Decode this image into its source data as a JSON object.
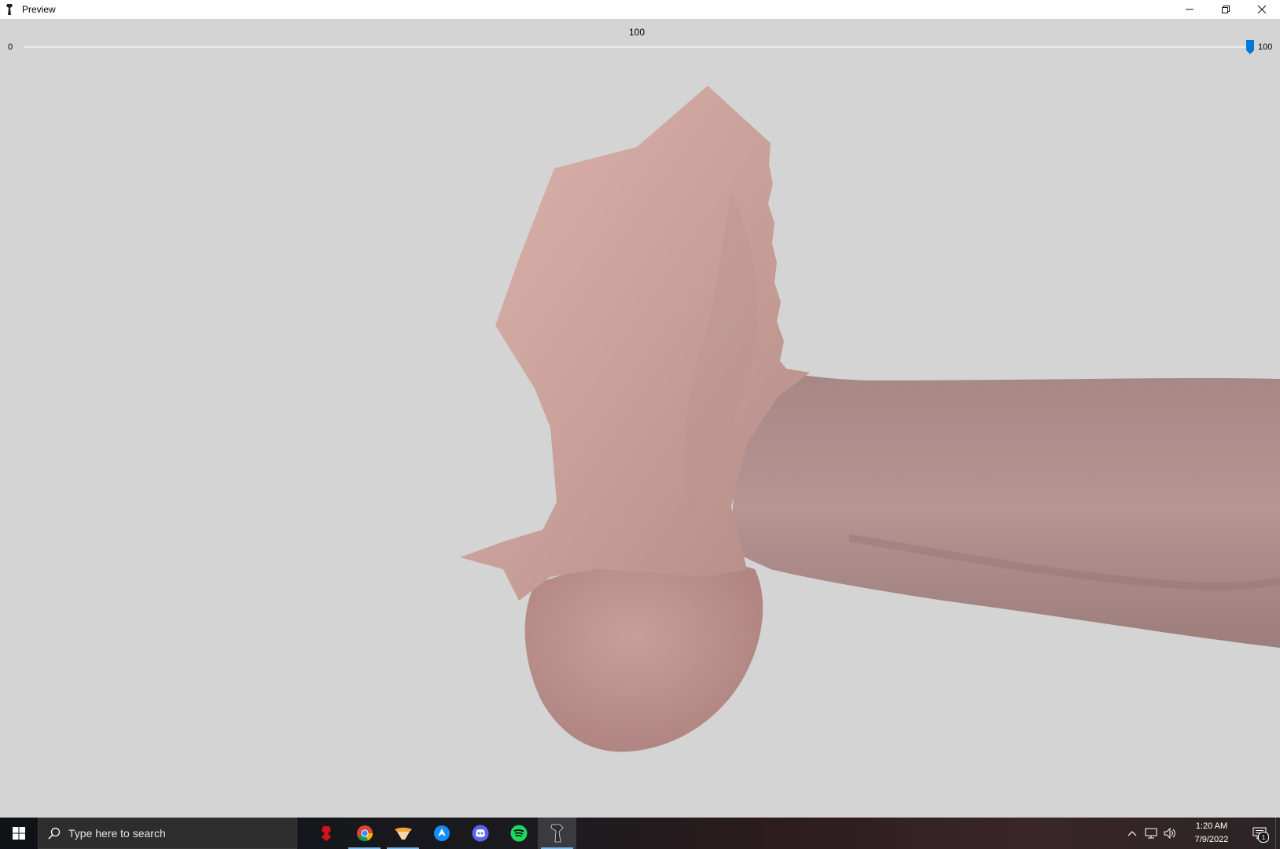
{
  "window": {
    "title": "Preview",
    "controls": [
      "minimize-icon",
      "restore-icon",
      "close-icon"
    ]
  },
  "slider": {
    "value_label": "100",
    "min_label": "0",
    "max_label": "100",
    "value": 100,
    "min": 0,
    "max": 100,
    "accent_color": "#0078d7"
  },
  "viewport": {
    "background": "#d4d4d4",
    "model_color": "#c4a09a"
  },
  "taskbar": {
    "search_placeholder": "Type here to search",
    "apps": [
      {
        "name": "red-app-icon",
        "running": false
      },
      {
        "name": "chrome-icon",
        "running": true
      },
      {
        "name": "orange-app-icon",
        "running": true
      },
      {
        "name": "blue-app-icon",
        "running": false
      },
      {
        "name": "discord-icon",
        "running": false
      },
      {
        "name": "spotify-icon",
        "running": false
      },
      {
        "name": "preview-app-icon",
        "running": true,
        "active": true
      }
    ],
    "clock_time": "1:20 AM",
    "clock_date": "7/9/2022",
    "notification_count": "1"
  }
}
